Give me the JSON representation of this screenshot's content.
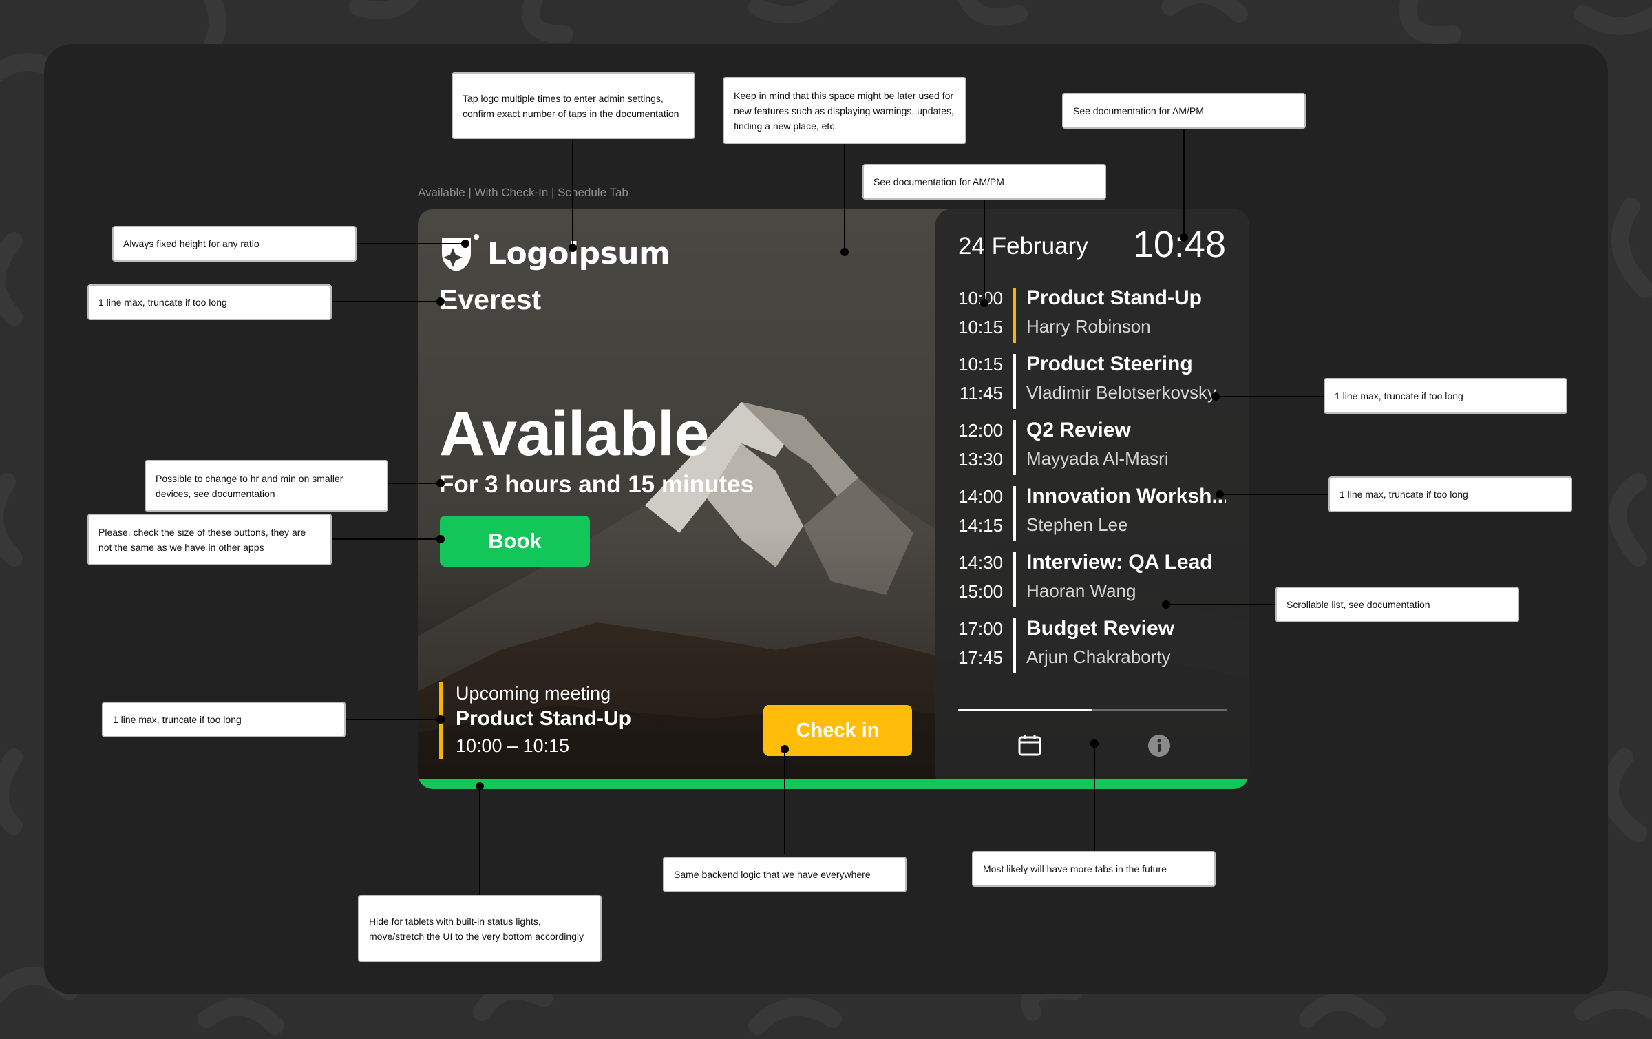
{
  "caption": "Available | With Check-In | Schedule Tab",
  "logo": {
    "text": "Logoipsum"
  },
  "room": {
    "name": "Everest"
  },
  "status": {
    "title": "Available",
    "subtitle": "For 3 hours and 15 minutes"
  },
  "book_button": {
    "label": "Book"
  },
  "upcoming": {
    "label": "Upcoming meeting",
    "title": "Product Stand-Up",
    "time": "10:00 – 10:15"
  },
  "checkin_button": {
    "label": "Check in"
  },
  "panel": {
    "date": "24 February",
    "time": "10:48",
    "meetings": [
      {
        "start": "10:00",
        "end": "10:15",
        "title": "Product Stand-Up",
        "organizer": "Harry Robinson",
        "current": true
      },
      {
        "start": "10:15",
        "end": "11:45",
        "title": "Product Steering",
        "organizer": "Vladimir Belotserkovsky",
        "current": false
      },
      {
        "start": "12:00",
        "end": "13:30",
        "title": "Q2 Review",
        "organizer": "Mayyada Al-Masri",
        "current": false
      },
      {
        "start": "14:00",
        "end": "14:15",
        "title": "Innovation Worksh...",
        "organizer": "Stephen Lee",
        "current": false
      },
      {
        "start": "14:30",
        "end": "15:00",
        "title": "Interview: QA Lead",
        "organizer": "Haoran Wang",
        "current": false
      },
      {
        "start": "17:00",
        "end": "17:45",
        "title": "Budget Review",
        "organizer": "Arjun Chakraborty",
        "current": false
      }
    ],
    "scroll_fraction": 0.5,
    "tabs": [
      {
        "icon": "calendar-icon",
        "active": true
      },
      {
        "icon": "info-icon",
        "active": false
      }
    ]
  },
  "annotations": {
    "logo_taps": "Tap logo multiple times to enter admin settings, confirm exact number of taps in the documentation",
    "space_later": "Keep in mind that this space might be later used for new features such as displaying warnings, updates, finding a new place, etc.",
    "ampm_clock": "See documentation for AM/PM",
    "ampm_times": "See documentation for AM/PM",
    "fixed_height": "Always fixed height for any ratio",
    "room_truncate": "1 line max, truncate if too long",
    "organizer_truncate": "1 line max, truncate if too long",
    "title_truncate": "1 line max, truncate if too long",
    "duration_format": "Possible to change to hr and min on smaller devices, see documentation",
    "button_size": "Please, check the size of these buttons, they are not the same as we have in other apps",
    "scrollable": "Scrollable list, see documentation",
    "upcoming_truncate": "1 line max, truncate if too long",
    "checkin_logic": "Same backend logic that we have everywhere",
    "more_tabs": "Most likely will have more tabs in the future",
    "status_lights": "Hide for tablets with built-in status lights, move/stretch the UI to the very bottom accordingly"
  },
  "colors": {
    "available_green": "#12c65a",
    "checkin_yellow": "#ffbd0a",
    "current_marker": "#f7b500"
  }
}
